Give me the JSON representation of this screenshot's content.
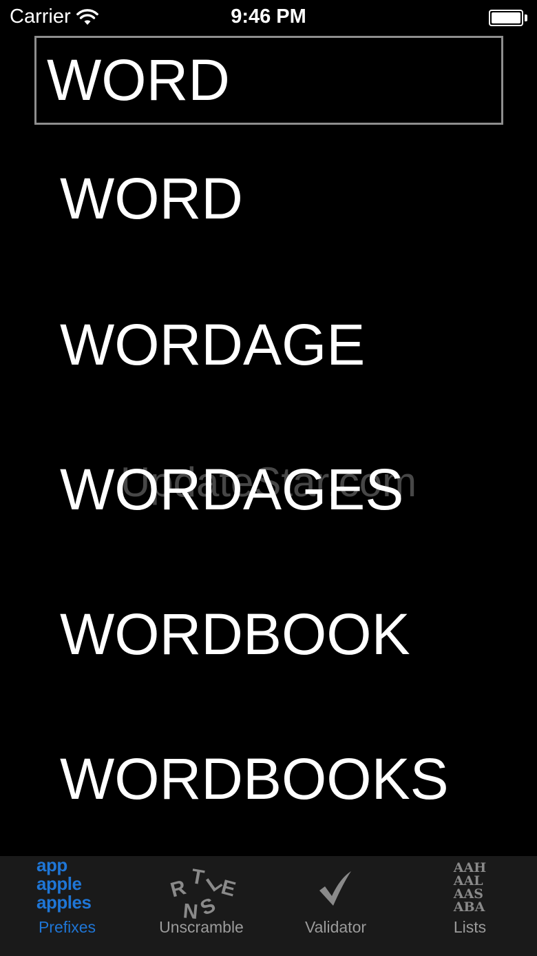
{
  "status_bar": {
    "carrier": "Carrier",
    "time": "9:46 PM"
  },
  "search": {
    "value": "WORD"
  },
  "words": [
    "WORD",
    "WORDAGE",
    "WORDAGES",
    "WORDBOOK",
    "WORDBOOKS"
  ],
  "watermark": "UpdateStar.com",
  "tabs": [
    {
      "label": "Prefixes",
      "icon": "prefixes-icon",
      "active": true
    },
    {
      "label": "Unscramble",
      "icon": "scrambled-letters-icon",
      "active": false
    },
    {
      "label": "Validator",
      "icon": "checkmark-icon",
      "active": false
    },
    {
      "label": "Lists",
      "icon": "word-list-icon",
      "active": false
    }
  ],
  "prefix_icon_lines": [
    "app",
    "apple",
    "apples"
  ],
  "lists_icon_lines": [
    "AAH",
    "AAL",
    "AAS",
    "ABA"
  ],
  "unscramble_icon_letters": [
    "R",
    "T",
    "L",
    "E",
    "N",
    "S"
  ],
  "colors": {
    "background": "#000000",
    "tab_bar": "#1a1a1a",
    "active_tab": "#1f76d6",
    "inactive_tab": "#9b9b9b",
    "input_border": "#8e8e8e"
  }
}
